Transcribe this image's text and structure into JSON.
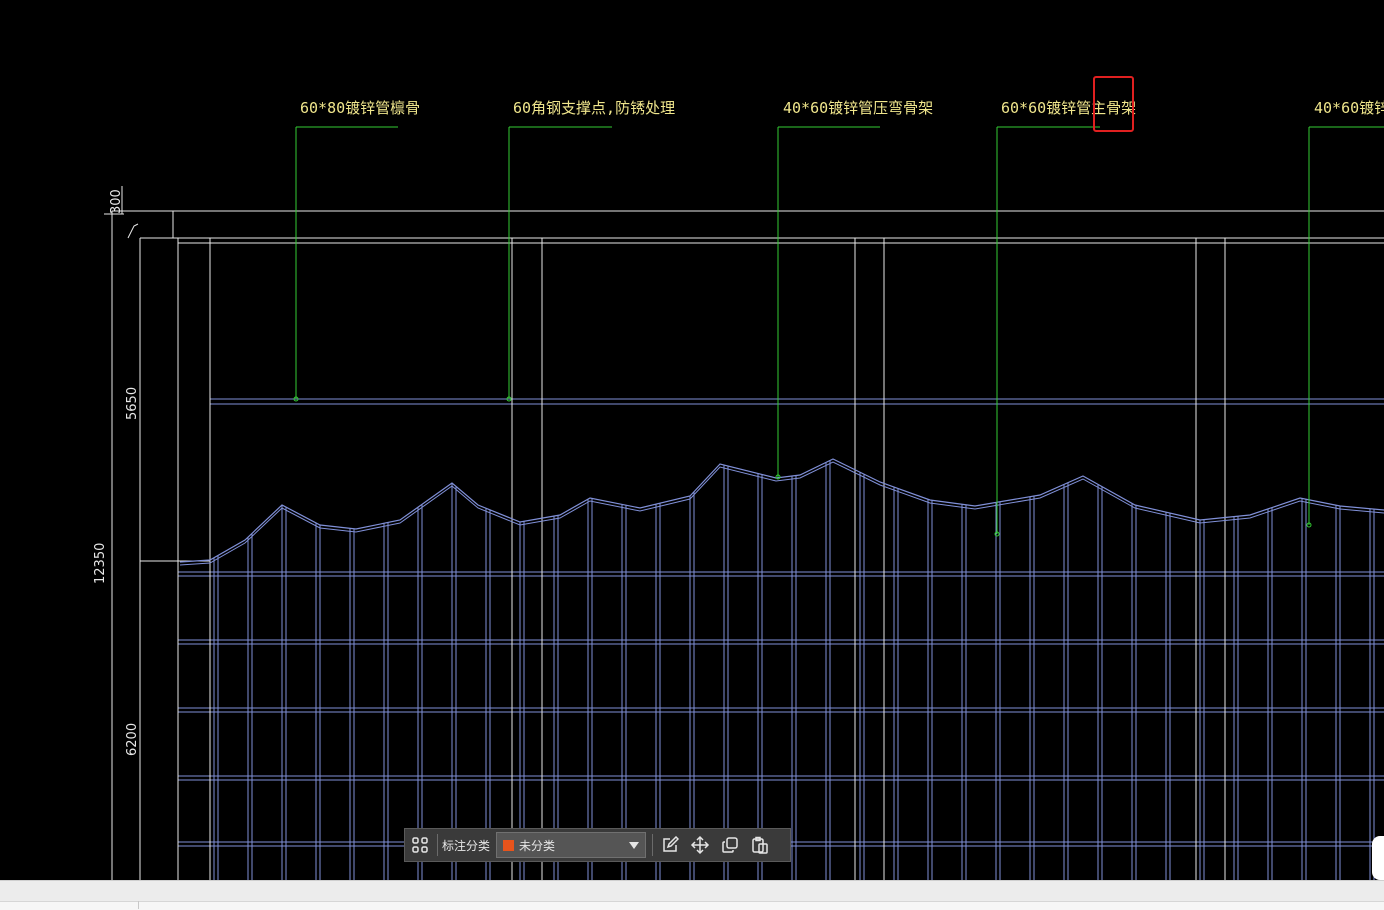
{
  "annotations": [
    {
      "label": "60*80镀锌管檩骨"
    },
    {
      "label": "60角钢支撑点,防锈处理"
    },
    {
      "label": "40*60镀锌管压弯骨架"
    },
    {
      "label": "60*60镀锌管主骨架"
    },
    {
      "label": "40*60镀锌"
    }
  ],
  "dimensions": {
    "top": "300",
    "upper": "5650",
    "total": "12350",
    "lower": "6200"
  },
  "highlight_color": "#e02020",
  "colors": {
    "leader": "#33cc33",
    "annotation_text": "#f0e68c",
    "grid_blue": "#8090d8",
    "frame_white": "#e8e8e8",
    "swatch_orange": "#e8541c"
  },
  "toolbar": {
    "category_label": "标注分类",
    "category_value": "未分类",
    "icons": [
      "grid-icon",
      "edit-icon",
      "move-icon",
      "copy-icon",
      "paste-icon"
    ]
  }
}
